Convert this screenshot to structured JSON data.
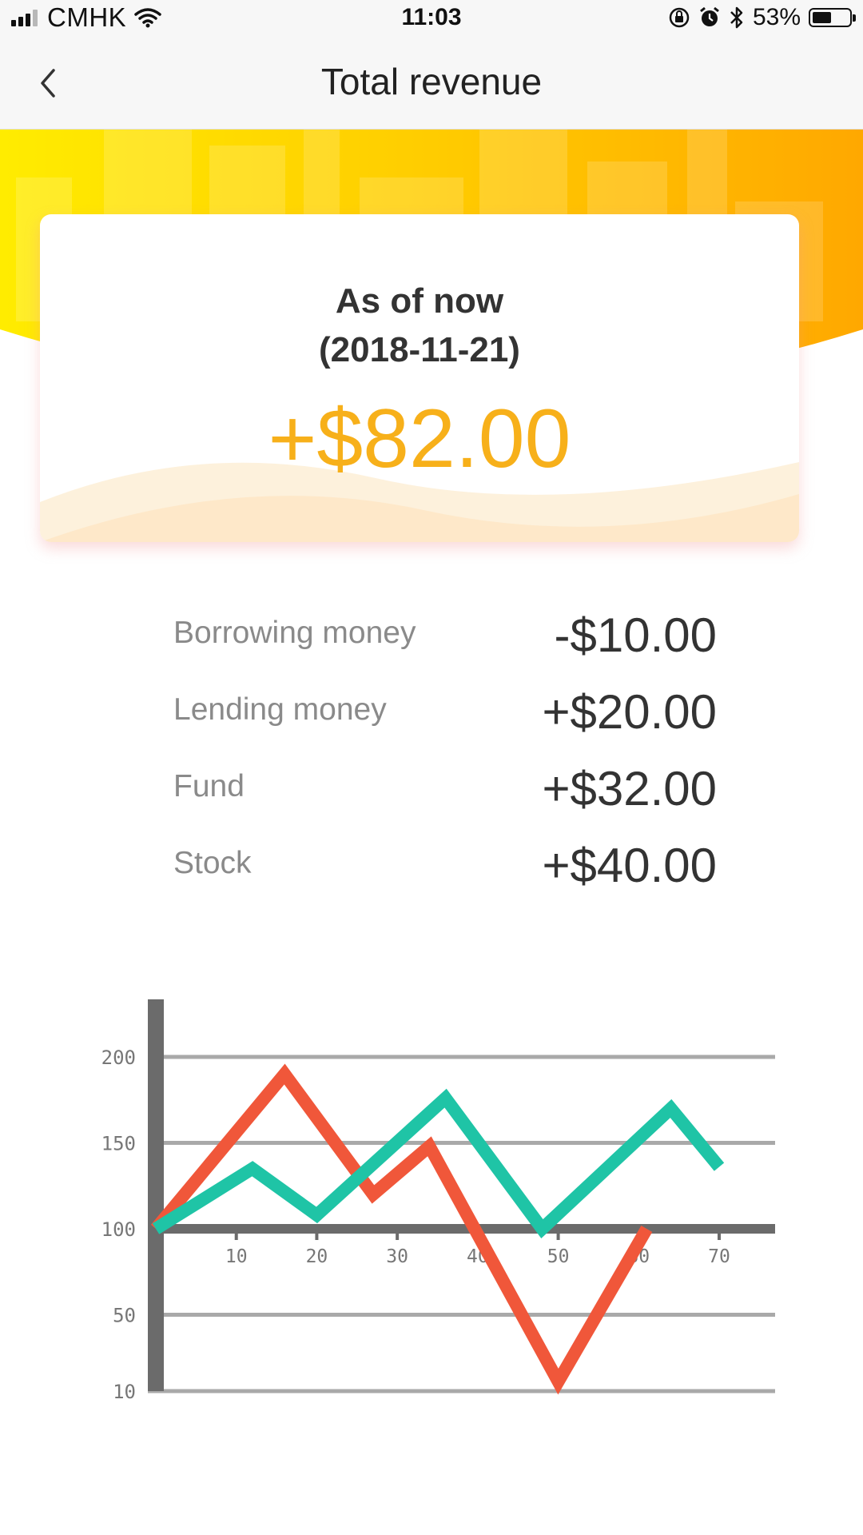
{
  "status_bar": {
    "carrier": "CMHK",
    "time": "11:03",
    "battery_percent": "53%",
    "battery_level": 0.53,
    "icons": [
      "signal-icon",
      "wifi-icon",
      "lock-rotation-icon",
      "alarm-icon",
      "bluetooth-icon",
      "battery-icon"
    ]
  },
  "nav": {
    "title": "Total revenue",
    "back_icon": "chevron-left-icon"
  },
  "summary_card": {
    "label": "As of now",
    "date": "(2018-11-21)",
    "amount": "+$82.00"
  },
  "breakdown": [
    {
      "label": "Borrowing money",
      "value": "-$10.00"
    },
    {
      "label": "Lending money",
      "value": "+$20.00"
    },
    {
      "label": "Fund",
      "value": "+$32.00"
    },
    {
      "label": "Stock",
      "value": "+$40.00"
    }
  ],
  "colors": {
    "accent": "#f7b01a",
    "banner_start": "#ffe800",
    "banner_end": "#ffad00",
    "series_red": "#f0573a",
    "series_teal": "#1fc4a6",
    "axis": "#6b6b6b",
    "grid": "#a9a9a9"
  },
  "chart_data": {
    "type": "line",
    "y_ticks": [
      200,
      150,
      100,
      50,
      10
    ],
    "x_ticks": [
      10,
      20,
      30,
      40,
      50,
      60,
      70
    ],
    "ylim": [
      10,
      200
    ],
    "xlim": [
      0,
      73
    ],
    "baseline": 100,
    "grid": true,
    "series": [
      {
        "color": "#f0573a",
        "x": [
          0,
          16,
          27,
          34,
          50,
          61
        ],
        "y": [
          100,
          190,
          120,
          148,
          15,
          100
        ]
      },
      {
        "color": "#1fc4a6",
        "x": [
          0,
          12,
          20,
          36,
          48,
          64,
          70
        ],
        "y": [
          100,
          135,
          108,
          176,
          100,
          170,
          136
        ]
      }
    ]
  }
}
